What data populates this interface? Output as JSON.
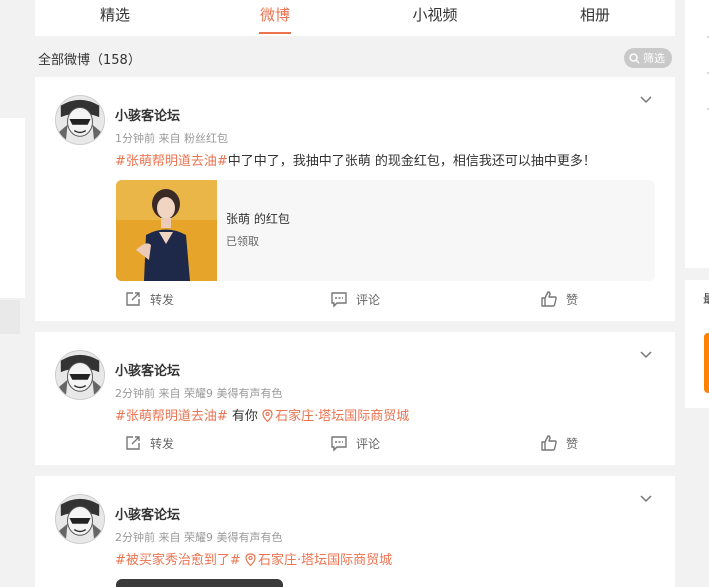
{
  "tabs": [
    {
      "label": "精选",
      "active": false
    },
    {
      "label": "微博",
      "active": true
    },
    {
      "label": "小视频",
      "active": false
    },
    {
      "label": "相册",
      "active": false
    }
  ],
  "feed": {
    "count_label": "全部微博（158）",
    "filter_label": "筛选"
  },
  "posts": [
    {
      "username": "小骇客论坛",
      "meta": "1分钟前  来自 粉丝红包",
      "topic": "#张萌帮明道去油#",
      "text": "中了中了，我抽中了张萌 的现金红包，相信我还可以抽中更多！",
      "redpacket": {
        "title": "张萌 的红包",
        "status": "已领取"
      },
      "actions": {
        "repost": "转发",
        "comment": "评论",
        "like": "赞"
      }
    },
    {
      "username": "小骇客论坛",
      "meta": "2分钟前  来自 荣耀9 美得有声有色",
      "topic": "#张萌帮明道去油#",
      "text": " 有你 ",
      "location": "石家庄·塔坛国际商贸城",
      "actions": {
        "repost": "转发",
        "comment": "评论",
        "like": "赞"
      }
    },
    {
      "username": "小骇客论坛",
      "meta": "2分钟前  来自 荣耀9 美得有声有色",
      "topic": "#被买家秀治愈到了#",
      "text": " ",
      "location": "石家庄·塔坛国际商贸城"
    }
  ],
  "right_panel": {
    "text": "最"
  },
  "colors": {
    "accent": "#eb7350",
    "orange": "#ff8200",
    "filter_bg": "#c9c9c9"
  },
  "icons": [
    "search-icon",
    "chevron-down-icon",
    "repost-icon",
    "comment-icon",
    "like-icon",
    "location-icon"
  ]
}
